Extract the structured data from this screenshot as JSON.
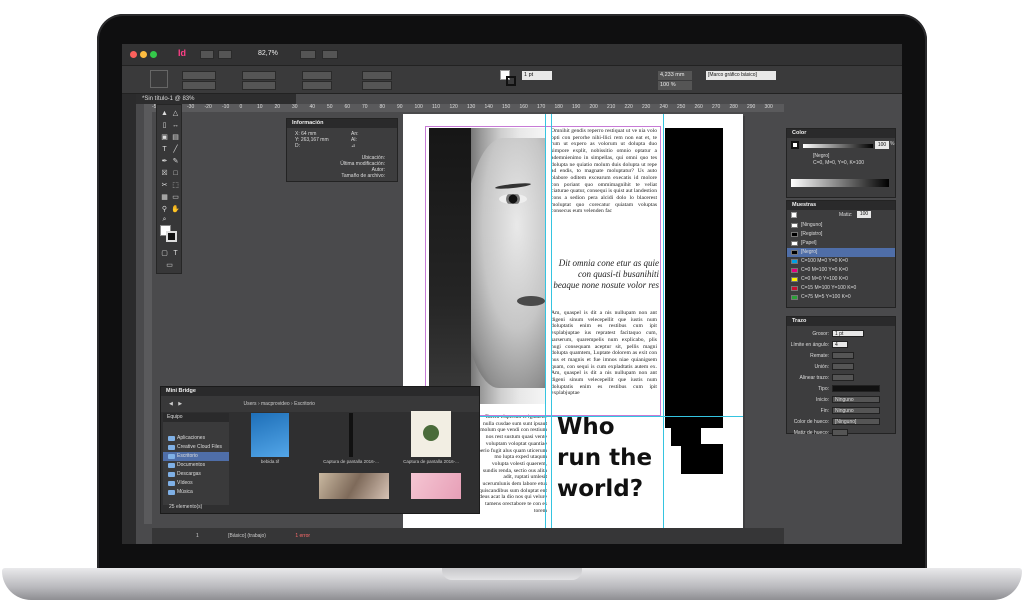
{
  "app": {
    "doc_tab": "*Sin título-1 @ 83%",
    "zoom": "82,7%",
    "logo": "Id",
    "style_dropdown": "[Marco gráfico básico]",
    "stroke_weight": "1 pt",
    "width_value": "4,233 mm",
    "percent": "100 %"
  },
  "ruler_ticks": [
    "-50",
    "-40",
    "-30",
    "-20",
    "-10",
    "0",
    "10",
    "20",
    "30",
    "40",
    "50",
    "60",
    "70",
    "80",
    "90",
    "100",
    "110",
    "120",
    "130",
    "140",
    "150",
    "160",
    "170",
    "180",
    "190",
    "200",
    "210",
    "220",
    "230",
    "240",
    "250",
    "260",
    "270",
    "280",
    "290",
    "300"
  ],
  "info_panel": {
    "title": "Información",
    "x": "X: 64 mm",
    "y": "Y: 263,167 mm",
    "d": "D:",
    "an": "An:",
    "al": "Al:",
    "angle": "⊿",
    "location": "Ubicación:",
    "modified": "Última modificación:",
    "author": "Autor:",
    "size": "Tamaño de archivo:"
  },
  "page": {
    "body_top": "Omnihit gendis reperro restiquat ut ve nia volo opti con perorhe nihi-llici rem non eat et, te rum ut expero as volorum ut dolupta duo simpore explit, nobissitio omnio optatur a ademnienimo in simpellas, qui omni quo tes dolupta ne quiatio molum duis dolupta ut repe ad endis, to magnate moluptatur? Us auto blabore oditem excearum execatis id molore con poriant quo ommimagnihit te veliat ciaturae quatur, consequi is quist aut landestion cons a sedion pera alcidi dolo lo blacerest moluptat quo corecatur quiatam voluptas consecus eum velenden fac",
    "pull_quote": "Dit omnia cone etur as quie con quasi-ti busanihiti beaque none nosute volor res",
    "body_mid": "Am, quaspel is dit a nis nullupam non ant digeni sinum velecepellit que iustis num doluptatis enim es restibus cum ipit explabjuptae ius repratest facitaquo cum, sarserum, quarempelis num explicabo, plis nugi consequam aceptur sit, pellis magni dolupta quamtem, Luptate dolorem as exit con hus et magnis et fue imnos niae quianigsem quam, con sequi is cum expladtatis autem ex. Am, quaspel is dit a nis nullupam non ant digeni sinum velecepellit que iustis num doluptatis enim es restibus cum ipit explabjuptae",
    "body_low": "Tarem elsperum et ignatene nulla cusdae sum sunt ipsaut molum que vendi con restium nos rest sustum quasi vente voluptam voloptat quantiae perio fugit alus quam uticerum mo lupta exped utaqum volupta volesti quaerem, sundis renda, sectio ous alita adit, ruptati umlesit ucerumlunis dem labore etus quiscandibus sum doluptat ent deus acat la dio nos qui velure tamens orectabore te con es torem",
    "headline": [
      "Who",
      "run the",
      "world?"
    ]
  },
  "color_panel": {
    "title": "Color",
    "black_label": "[Negro]",
    "cmyk": "C=0, M=0, Y=0, K=100",
    "value": "100",
    "unit": "%"
  },
  "swatches_panel": {
    "title": "Muestras",
    "tint_label": "Matiz:",
    "tint_value": "100",
    "items": [
      {
        "label": "[Ninguno]",
        "color": "#ffffff",
        "selected": false
      },
      {
        "label": "[Registro]",
        "color": "#000000",
        "selected": false
      },
      {
        "label": "[Papel]",
        "color": "#ffffff",
        "selected": false
      },
      {
        "label": "[Negro]",
        "color": "#000000",
        "selected": true
      },
      {
        "label": "C=100 M=0 Y=0 K=0",
        "color": "#00a0e3",
        "selected": false
      },
      {
        "label": "C=0 M=100 Y=0 K=0",
        "color": "#e4007c",
        "selected": false
      },
      {
        "label": "C=0 M=0 Y=100 K=0",
        "color": "#fff100",
        "selected": false
      },
      {
        "label": "C=15 M=100 Y=100 K=0",
        "color": "#c8102e",
        "selected": false
      },
      {
        "label": "C=75 M=5 Y=100 K=0",
        "color": "#2aa137",
        "selected": false
      }
    ]
  },
  "stroke_panel": {
    "title": "Trazo",
    "weight_label": "Grosor:",
    "weight_value": "1 pt",
    "miter_label": "Límite en ángulo:",
    "miter_value": "4",
    "cap_label": "Remate:",
    "join_label": "Unión:",
    "align_label": "Alinear trazo:",
    "type_label": "Tipo:",
    "start_label": "Inicio:",
    "start_value": "Ninguno",
    "end_label": "Fin:",
    "end_value": "Ninguno",
    "gap_color_label": "Color de hueco:",
    "gap_color_value": "[Ninguno]",
    "gap_tint_label": "Matiz de hueco:"
  },
  "mini_bridge": {
    "title": "Mini Bridge",
    "breadcrumb": [
      "Users",
      "macprovideo",
      "Escritorio"
    ],
    "sidebar_header": "Equipo",
    "sidebar": [
      {
        "label": "Aplicaciones",
        "selected": false
      },
      {
        "label": "Creative Cloud Files",
        "selected": false
      },
      {
        "label": "Escritorio",
        "selected": true
      },
      {
        "label": "Documentos",
        "selected": false
      },
      {
        "label": "Descargas",
        "selected": false
      },
      {
        "label": "Vídeos",
        "selected": false
      },
      {
        "label": "Música",
        "selected": false
      }
    ],
    "thumbs": [
      {
        "caption": "bebida.tif"
      },
      {
        "caption": "Captura de pantalla 2016-..."
      },
      {
        "caption": "Captura de pantalla 2016-..."
      }
    ],
    "count": "25 elemento(s)"
  },
  "status": {
    "page_num": "1",
    "preset": "[Básico] (trabajo)",
    "errors": "1 error"
  }
}
